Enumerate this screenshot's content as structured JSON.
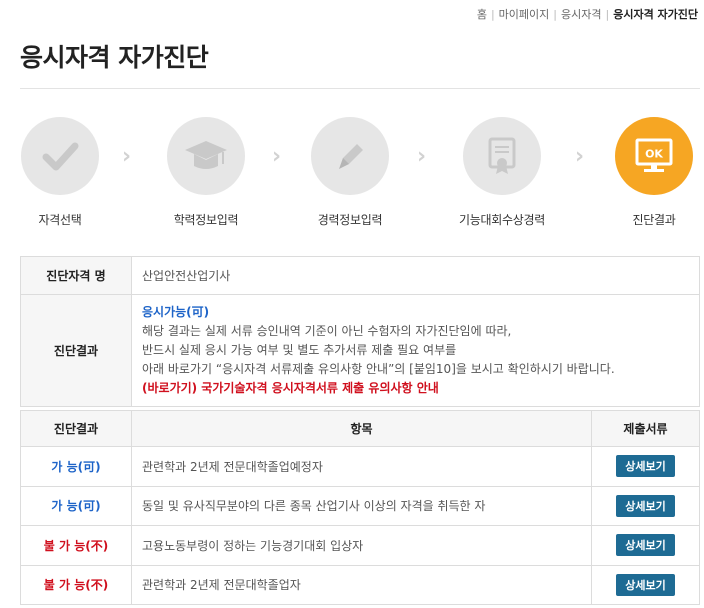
{
  "breadcrumb": [
    "홈",
    "마이페이지",
    "응시자격",
    "응시자격 자가진단"
  ],
  "page_title": "응시자격 자가진단",
  "steps": [
    {
      "label": "자격선택",
      "icon": "checkmark-icon",
      "active": false
    },
    {
      "label": "학력정보입력",
      "icon": "graduation-cap-icon",
      "active": false
    },
    {
      "label": "경력정보입력",
      "icon": "pencil-icon",
      "active": false
    },
    {
      "label": "기능대회수상경력",
      "icon": "certificate-icon",
      "active": false
    },
    {
      "label": "진단결과",
      "icon": "ok-monitor-icon",
      "active": true,
      "icon_text": "OK"
    }
  ],
  "info": {
    "name_label": "진단자격 명",
    "name_value": "산업안전산업기사",
    "result_label": "진단결과",
    "status": "응시가능(可)",
    "desc_lines": [
      "해당 결과는 실제 서류 승인내역 기준이 아닌 수험자의 자가진단임에 따라,",
      "반드시 실제 응시 가능 여부 및 별도 추가서류 제출 필요 여부를",
      "아래 바로가기 “응시자격 서류제출 유의사항 안내”의 [붙임10]을 보시고 확인하시기 바랍니다."
    ],
    "notice_link": "(바로가기) 국가기술자격 응시자격서류 제출 유의사항 안내"
  },
  "list": {
    "headers": [
      "진단결과",
      "항목",
      "제출서류"
    ],
    "button_label": "상세보기",
    "rows": [
      {
        "result": "가 능(可)",
        "status": "ok",
        "item": "관련학과 2년제 전문대학졸업예정자"
      },
      {
        "result": "가 능(可)",
        "status": "ok",
        "item": "동일 및 유사직무분야의 다른 종목 산업기사 이상의 자격을 취득한 자"
      },
      {
        "result": "불 가 능(不)",
        "status": "no",
        "item": "고용노동부령이 정하는 기능경기대회 입상자"
      },
      {
        "result": "불 가 능(不)",
        "status": "no",
        "item": "관련학과 2년제 전문대학졸업자"
      }
    ]
  },
  "colors": {
    "accent": "#f6a623",
    "possible": "#1e64c8",
    "impossible": "#d0101e",
    "button": "#1e6b94"
  }
}
